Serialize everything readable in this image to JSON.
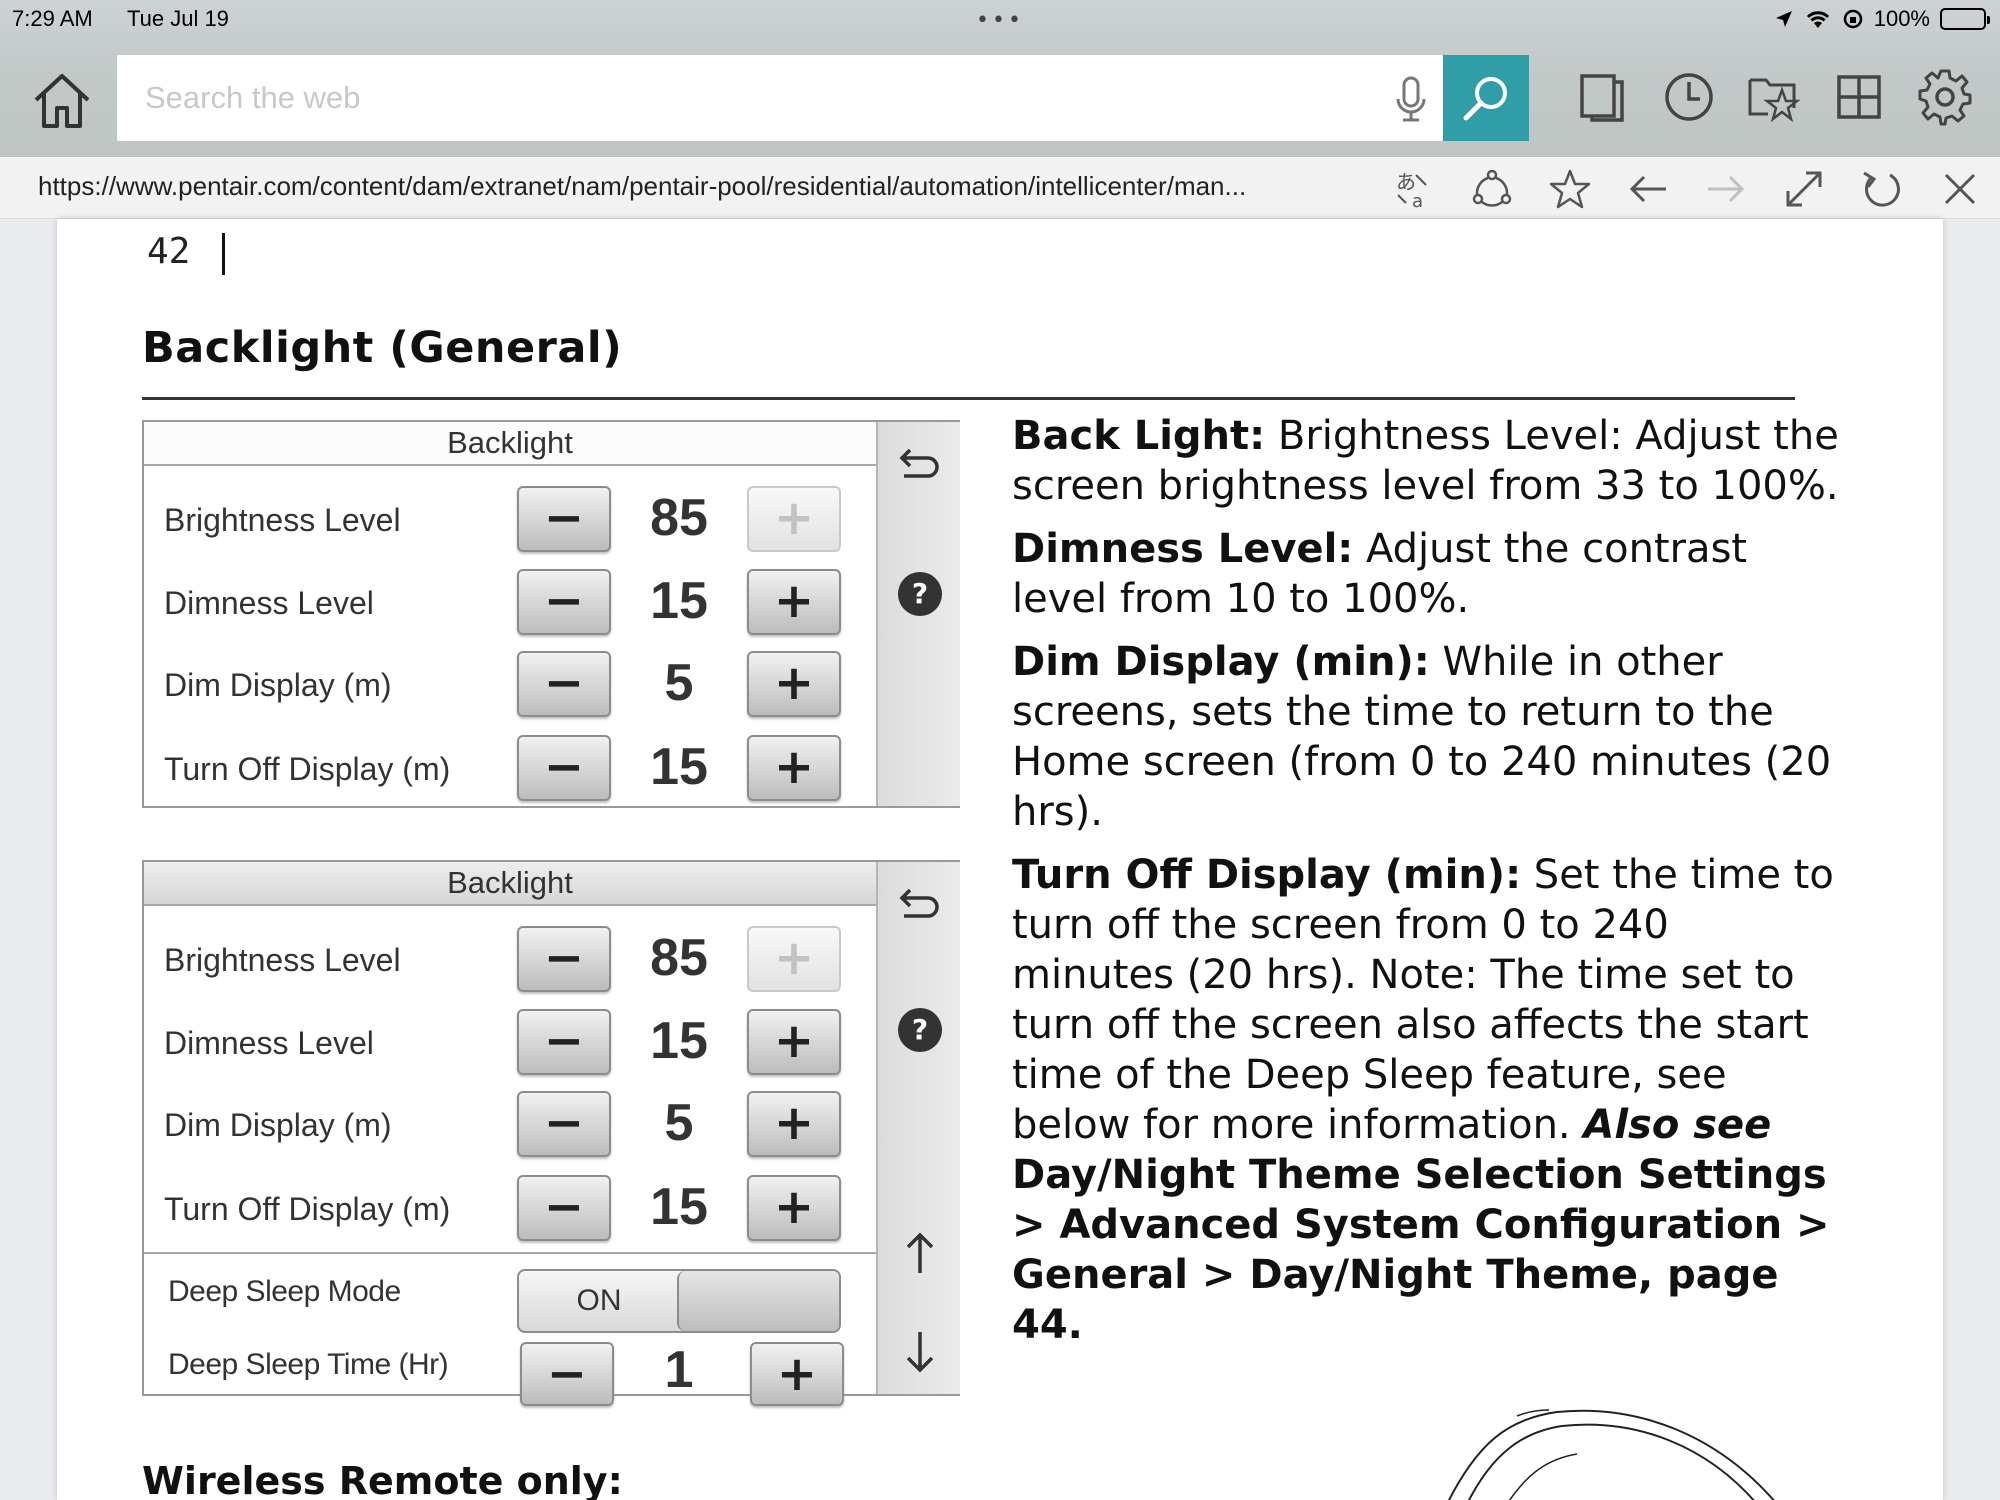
{
  "status_bar": {
    "time": "7:29 AM",
    "date": "Tue Jul 19",
    "dots": "•••",
    "battery": "100%"
  },
  "toolbar": {
    "search_placeholder": "Search the web",
    "icons": [
      "home-icon",
      "microphone-icon",
      "search-icon",
      "tabs-icon",
      "history-icon",
      "favorites-icon",
      "apps-grid-icon",
      "gear-icon"
    ]
  },
  "address_bar": {
    "url": "https://www.pentair.com/content/dam/extranet/nam/pentair-pool/residential/automation/intellicenter/man...",
    "icons": [
      "translate-icon",
      "share-icon",
      "star-icon",
      "back-arrow-icon",
      "forward-arrow-icon",
      "fullscreen-icon",
      "refresh-icon",
      "close-icon"
    ]
  },
  "document": {
    "page_number": "42",
    "section_title": "Backlight (General)",
    "panel1": {
      "title": "Backlight",
      "rows": [
        {
          "label": "Brightness Level",
          "value": "85",
          "minus": "−",
          "plus": "+",
          "plus_disabled": true
        },
        {
          "label": "Dimness Level",
          "value": "15",
          "minus": "−",
          "plus": "+"
        },
        {
          "label": "Dim Display (m)",
          "value": "5",
          "minus": "−",
          "plus": "+"
        },
        {
          "label": "Turn Off Display (m)",
          "value": "15",
          "minus": "−",
          "plus": "+"
        }
      ]
    },
    "panel2": {
      "title": "Backlight",
      "rows": [
        {
          "label": "Brightness Level",
          "value": "85",
          "minus": "−",
          "plus": "+",
          "plus_disabled": true
        },
        {
          "label": "Dimness Level",
          "value": "15",
          "minus": "−",
          "plus": "+"
        },
        {
          "label": "Dim Display (m)",
          "value": "5",
          "minus": "−",
          "plus": "+"
        },
        {
          "label": "Turn Off Display (m)",
          "value": "15",
          "minus": "−",
          "plus": "+"
        }
      ],
      "deep_sleep_mode": {
        "label": "Deep Sleep Mode",
        "state": "ON"
      },
      "deep_sleep_time": {
        "label": "Deep Sleep  Time (Hr)",
        "value": "1",
        "minus": "−",
        "plus": "+"
      }
    },
    "descriptions": {
      "back_light_term": "Back Light:",
      "back_light_text": " Brightness Level: Adjust the screen brightness level from 33 to 100%.",
      "dimness_term": "Dimness Level:",
      "dimness_text": " Adjust the contrast level from 10 to 100%.",
      "dim_display_term": "Dim Display (min):",
      "dim_display_text": " While in other screens, sets the time to return to the Home screen (from 0 to 240 minutes (20 hrs).",
      "turn_off_term": "Turn Off Display (min):",
      "turn_off_text": " Set the time to turn off the screen from 0 to 240 minutes (20 hrs). Note: The time set to turn off the screen also affects the start time of the Deep Sleep feature, see below for more information. ",
      "also_see": "Also see",
      "reference": " Day/Night Theme Selection Settings > Advanced System Configuration > General > Day/Night Theme, page 44."
    },
    "bottom_heading": "Wireless Remote only:"
  }
}
